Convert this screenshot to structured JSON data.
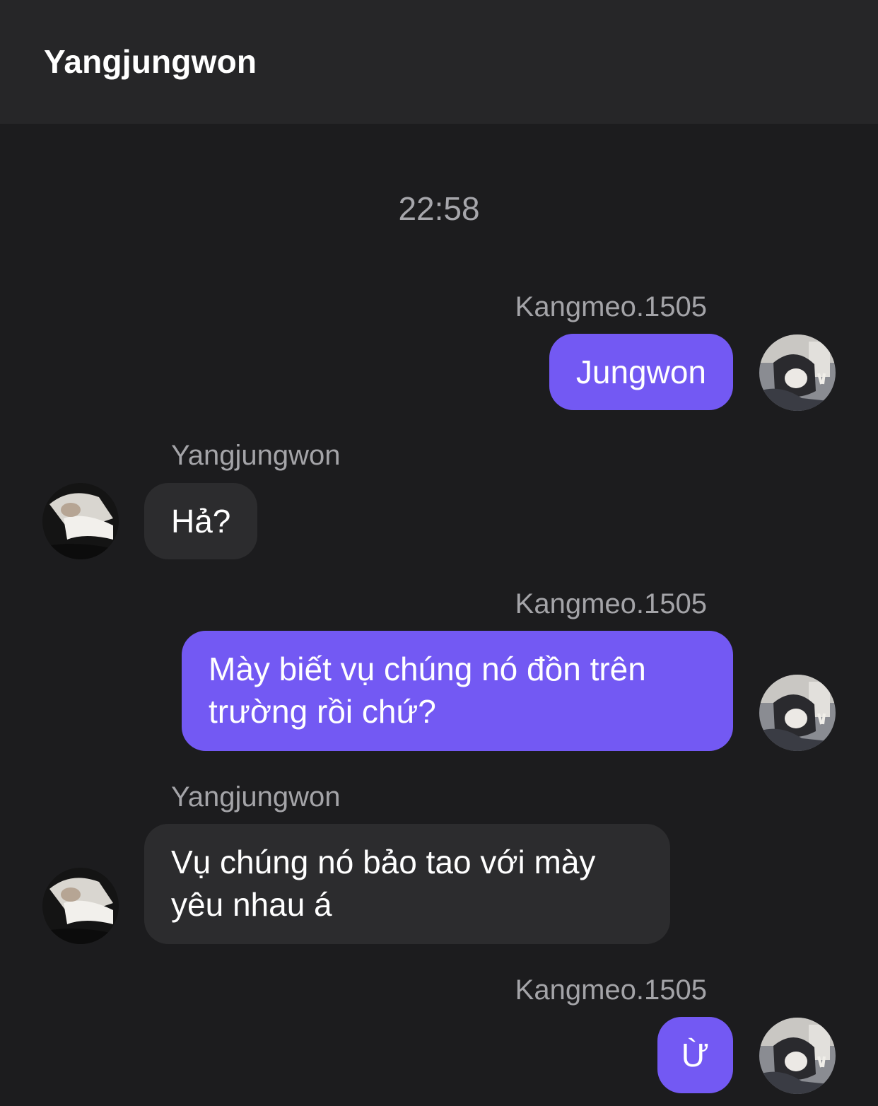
{
  "header": {
    "title": "Yangjungwon"
  },
  "conversation": {
    "timestamp": "22:58",
    "messages": [
      {
        "sender": "Kangmeo.1505",
        "text": "Jungwon",
        "side": "right"
      },
      {
        "sender": "Yangjungwon",
        "text": "Hả?",
        "side": "left"
      },
      {
        "sender": "Kangmeo.1505",
        "text": "Mày biết vụ chúng nó đồn trên trường rồi chứ?",
        "side": "right"
      },
      {
        "sender": "Yangjungwon",
        "text": "Vụ chúng nó bảo tao với mày yêu nhau á",
        "side": "left"
      },
      {
        "sender": "Kangmeo.1505",
        "text": "Ừ",
        "side": "right"
      }
    ]
  },
  "colors": {
    "background": "#1c1c1e",
    "header": "#262628",
    "own_bubble": "#7359f3",
    "other_bubble": "#2c2c2e",
    "meta_text": "#a4a4a8"
  },
  "icons": {
    "own_avatar": "user-photo-avatar",
    "other_avatar": "contact-photo-avatar"
  }
}
